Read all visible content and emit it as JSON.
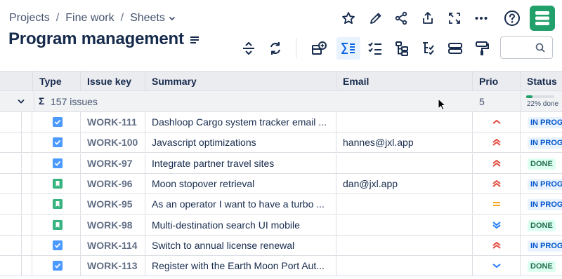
{
  "breadcrumb": {
    "items": [
      "Projects",
      "Fine work",
      "Sheets"
    ]
  },
  "page": {
    "title": "Program management"
  },
  "search": {
    "placeholder": ""
  },
  "table": {
    "headers": {
      "type": "Type",
      "key": "Issue key",
      "summary": "Summary",
      "email": "Email",
      "prio": "Prio",
      "status": "Status"
    },
    "group": {
      "sigma": "Σ",
      "label": "157 issues",
      "prio": "5",
      "progress_text": "22% done",
      "progress": 0.22
    },
    "rows": [
      {
        "type": "task",
        "key": "WORK-111",
        "summary": "Dashloop Cargo system tracker email ...",
        "email": "",
        "prio": "medium",
        "status": "IN PROGRESS",
        "status_kind": "prog"
      },
      {
        "type": "task",
        "key": "WORK-100",
        "summary": "Javascript optimizations",
        "email": "hannes@jxl.app",
        "prio": "high",
        "status": "IN PROGRESS",
        "status_kind": "prog"
      },
      {
        "type": "task",
        "key": "WORK-97",
        "summary": "Integrate partner travel sites",
        "email": "",
        "prio": "high",
        "status": "DONE",
        "status_kind": "done"
      },
      {
        "type": "story",
        "key": "WORK-96",
        "summary": "Moon stopover retrieval",
        "email": "dan@jxl.app",
        "prio": "high",
        "status": "IN PROGRESS",
        "status_kind": "prog"
      },
      {
        "type": "story",
        "key": "WORK-95",
        "summary": "As an operator I want to have a turbo ...",
        "email": "",
        "prio": "medium-flat",
        "status": "IN PROGRESS",
        "status_kind": "prog"
      },
      {
        "type": "story",
        "key": "WORK-98",
        "summary": "Multi-destination search UI mobile",
        "email": "",
        "prio": "lowest",
        "status": "DONE",
        "status_kind": "done"
      },
      {
        "type": "task",
        "key": "WORK-114",
        "summary": "Switch to annual license renewal",
        "email": "",
        "prio": "high",
        "status": "IN PROGRESS",
        "status_kind": "prog"
      },
      {
        "type": "task",
        "key": "WORK-113",
        "summary": "Register with the Earth Moon Port Aut...",
        "email": "",
        "prio": "low",
        "status": "DONE",
        "status_kind": "done"
      }
    ]
  },
  "colors": {
    "task": "#4c9aff",
    "story": "#36b37e",
    "prio_high": "#e2483d",
    "prio_medium": "#f5a623",
    "prio_low": "#1d7afc",
    "brand": "#22a06b"
  }
}
